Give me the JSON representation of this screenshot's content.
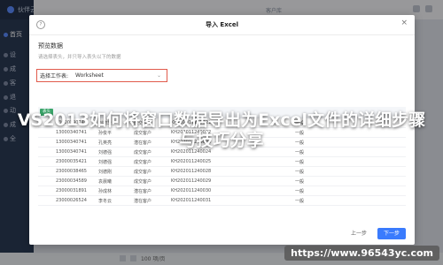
{
  "app": {
    "brand": "伙伴云大演示",
    "topbar_tab": "客户库",
    "sidebar": [
      {
        "label": "首页"
      },
      {
        "label": "设"
      },
      {
        "label": "成"
      },
      {
        "label": "客"
      },
      {
        "label": "退"
      },
      {
        "label": "动"
      },
      {
        "label": "成"
      },
      {
        "label": "全"
      }
    ],
    "pager": {
      "page_size": "100 项/页"
    }
  },
  "modal": {
    "title": "导入 Excel",
    "section_title": "预览数据",
    "section_hint": "请选择表头，并只导入表头以下的数据",
    "sheet_select": {
      "label": "选择工作表:",
      "value": "Worksheet"
    },
    "header_tag": "表头",
    "rows": [
      {
        "phone": "13000340741",
        "name": "刘德华",
        "status": "成交客户",
        "code": "KH202011240021",
        "level": "一般"
      },
      {
        "phone": "13000340741",
        "name": "孙俊平",
        "status": "成交客户",
        "code": "KH202011240022",
        "level": "一般"
      },
      {
        "phone": "13000340741",
        "name": "孔英亮",
        "status": "潜在客户",
        "code": "KH202011240023",
        "level": "一般"
      },
      {
        "phone": "13000340741",
        "name": "刘德强",
        "status": "成交客户",
        "code": "KH202011240024",
        "level": "一般"
      },
      {
        "phone": "23000035421",
        "name": "刘德强",
        "status": "成交客户",
        "code": "KH202011240025",
        "level": "一般"
      },
      {
        "phone": "23000038465",
        "name": "刘德刚",
        "status": "成交客户",
        "code": "KH202011240028",
        "level": "一般"
      },
      {
        "phone": "23000034589",
        "name": "袁晨曦",
        "status": "成交客户",
        "code": "KH202011240029",
        "level": "一般"
      },
      {
        "phone": "23000031891",
        "name": "孙成林",
        "status": "潜在客户",
        "code": "KH202011240030",
        "level": "一般"
      },
      {
        "phone": "23000026524",
        "name": "李冬云",
        "status": "潜在客户",
        "code": "KH202011240031",
        "level": "一般"
      }
    ],
    "prev_label": "上一步",
    "next_label": "下一步"
  },
  "banner": {
    "title": "VS2013如何将窗口数据导出为Excel文件的详细步骤与技巧分享"
  },
  "watermark": "https://www.96543yc.com",
  "colors": {
    "primary": "#3a7bfd",
    "select_border": "#e15b4c",
    "header_tag": "#3aa56a",
    "sidebar": "#2b3a55"
  }
}
